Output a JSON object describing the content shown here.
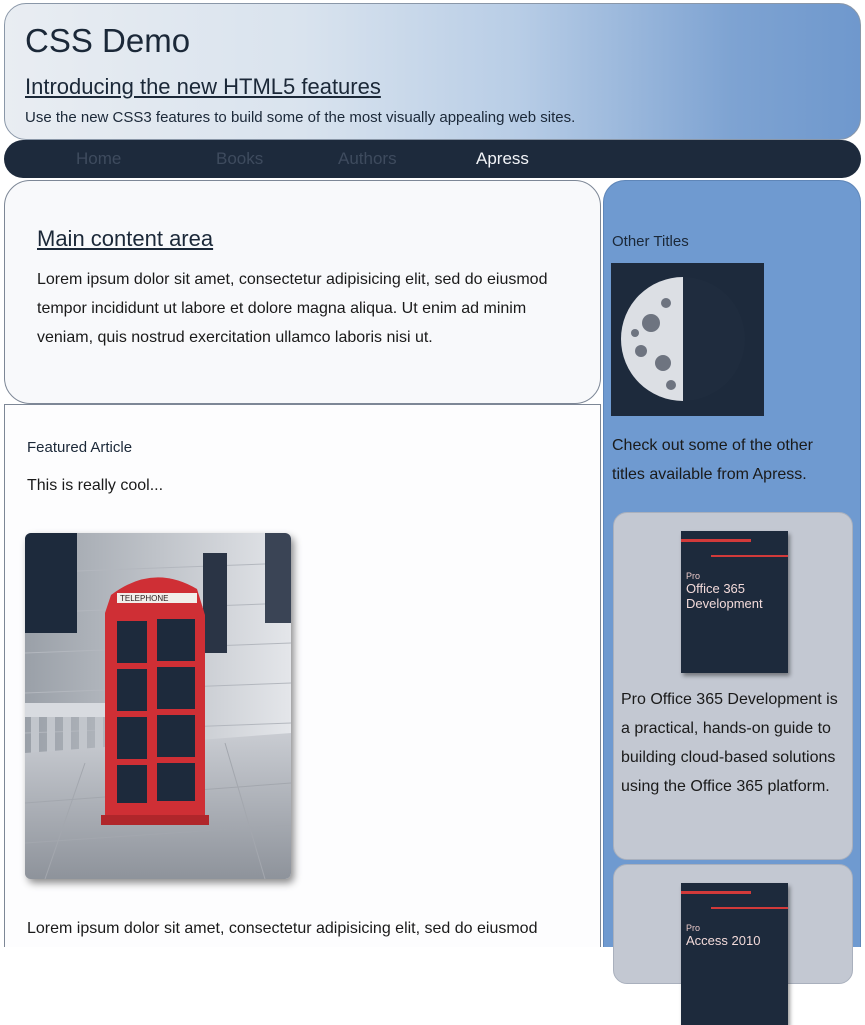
{
  "header": {
    "title": "CSS Demo",
    "subtitle": "Introducing the new HTML5 features",
    "tagline": "Use the new CSS3 features to build some of the most visually appealing web sites."
  },
  "nav": {
    "items": [
      {
        "label": "Home"
      },
      {
        "label": "Books"
      },
      {
        "label": "Authors"
      },
      {
        "label": "Apress"
      }
    ]
  },
  "main": {
    "heading": "Main content area",
    "text": "Lorem ipsum dolor sit amet, consectetur adipisicing elit, sed do eiusmod tempor incididunt ut labore et dolore magna aliqua. Ut enim ad minim veniam, quis nostrud exercitation ullamco laboris nisi ut."
  },
  "featured": {
    "heading": "Featured Article",
    "intro": "This is really cool...",
    "photo_sign": "TELEPHONE",
    "body": "Lorem ipsum dolor sit amet, consectetur adipisicing elit, sed do eiusmod"
  },
  "sidebar": {
    "heading": "Other Titles",
    "lead": "Check out some of the other titles available from Apress.",
    "books": [
      {
        "cover_series": "Pro",
        "cover_title": "Office 365 Development",
        "description": "Pro Office 365 Development is a practical, hands-on guide to building cloud-based solutions using the Office 365 platform."
      },
      {
        "cover_series": "Pro",
        "cover_title": "Access 2010",
        "description": ""
      }
    ]
  },
  "colors": {
    "nav_bg": "#1d2a3c",
    "sidebar_bg": "#6f9ad0",
    "accent_red": "#d23a3a"
  }
}
